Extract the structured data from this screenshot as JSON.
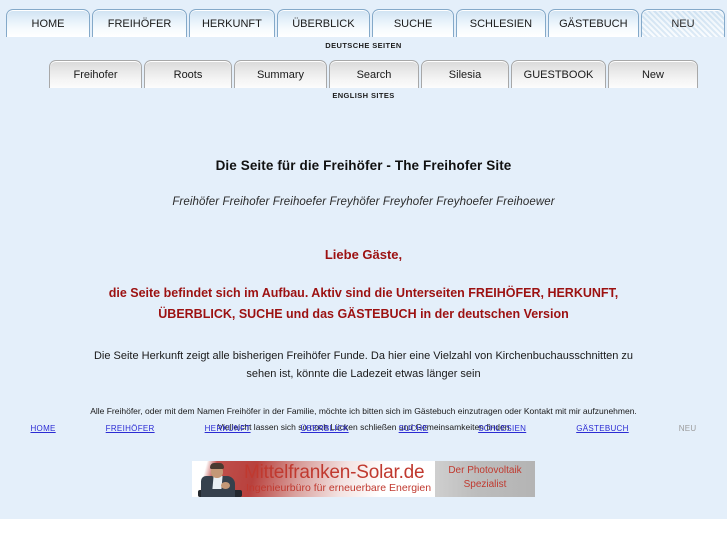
{
  "nav": {
    "german": {
      "caption": "DEUTSCHE SEITEN",
      "tabs": [
        {
          "label": "HOME",
          "state": "active"
        },
        {
          "label": "FREIHÖFER",
          "state": "active"
        },
        {
          "label": "HERKUNFT",
          "state": "active"
        },
        {
          "label": "ÜBERBLICK",
          "state": "active"
        },
        {
          "label": "SUCHE",
          "state": "active"
        },
        {
          "label": "SCHLESIEN",
          "state": "active"
        },
        {
          "label": "GÄSTEBUCH",
          "state": "active"
        },
        {
          "label": "NEU",
          "state": "disabled"
        }
      ]
    },
    "english": {
      "caption": "ENGLISH SITES",
      "tabs": [
        {
          "label": "Freihofer",
          "state": "active"
        },
        {
          "label": "Roots",
          "state": "active"
        },
        {
          "label": "Summary",
          "state": "active"
        },
        {
          "label": "Search",
          "state": "active"
        },
        {
          "label": "Silesia",
          "state": "active"
        },
        {
          "label": "GUESTBOOK",
          "state": "active"
        },
        {
          "label": "New",
          "state": "active"
        }
      ]
    }
  },
  "main": {
    "headline": "Die Seite für die Freihöfer - The Freihofer Site",
    "subheadline": "Freihöfer Freihofer Freihoefer Freyhöfer Freyhofer Freyhoefer Freihoewer",
    "greeting": "Liebe Gäste,",
    "notice_line1": "die Seite befindet sich im Aufbau. Aktiv sind die Unterseiten FREIHÖFER, HERKUNFT,",
    "notice_line2": "ÜBERBLICK, SUCHE und das GÄSTEBUCH in der deutschen Version",
    "para1_line1": "Die Seite Herkunft zeigt alle bisherigen Freihöfer Funde. Da hier eine Vielzahl von Kirchenbuchausschnitten zu",
    "para1_line2": "sehen ist, könnte die Ladezeit etwas länger sein",
    "para2_line1": "Alle Freihöfer, oder mit dem Namen Freihöfer in der Familie, möchte ich bitten sich im Gästebuch einzutragen oder Kontakt mit mir aufzunehmen.",
    "para2_line2": "Vielleicht lassen sich so noch Lücken schließen und Gemeinsamkeiten finden"
  },
  "footer": {
    "links": [
      {
        "label": "HOME",
        "state": "link"
      },
      {
        "label": "FREIHÖFER",
        "state": "link"
      },
      {
        "label": "HERKUNFT",
        "state": "link"
      },
      {
        "label": "ÜBERBLICK",
        "state": "link"
      },
      {
        "label": "SUCHE",
        "state": "link"
      },
      {
        "label": "SCHLESIEN",
        "state": "link"
      },
      {
        "label": "GÄSTEBUCH",
        "state": "link"
      },
      {
        "label": "NEU",
        "state": "inactive"
      }
    ]
  },
  "banner": {
    "title": "Mittelfranken-Solar.de",
    "subtitle": "Ingenieurbüro für erneuerbare Energien",
    "tagline_line1": "Der Photovoltaik",
    "tagline_line2": "Spezialist"
  },
  "colors": {
    "page_background": "#e4effa",
    "accent_red": "#9c1111",
    "link_blue": "#2b2bd4",
    "banner_red": "#c0392f",
    "tab_border_blue": "#84a9c9"
  }
}
